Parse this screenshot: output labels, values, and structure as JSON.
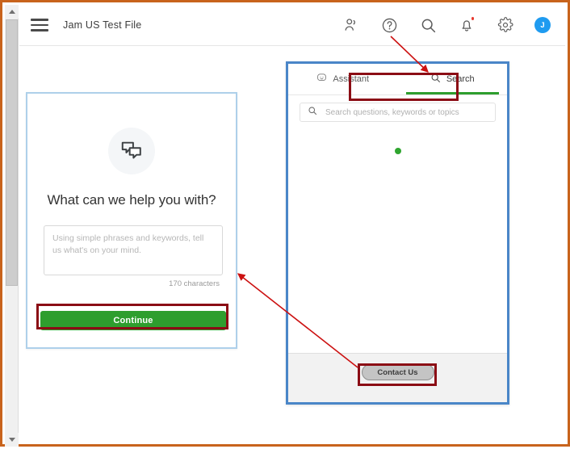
{
  "window": {
    "border_color": "#c8631c",
    "annotation_color": "#8b0d15"
  },
  "topbar": {
    "menu_icon": "hamburger-menu-icon",
    "title": "Jam US Test File",
    "icons": [
      {
        "name": "people-icon",
        "label": "People"
      },
      {
        "name": "help-icon",
        "label": "Help"
      },
      {
        "name": "search-icon",
        "label": "Search"
      },
      {
        "name": "notifications-bell-icon",
        "label": "Notifications",
        "badge": true
      },
      {
        "name": "settings-gear-icon",
        "label": "Settings"
      }
    ],
    "avatar_initial": "J",
    "avatar_color": "#1f9bf0"
  },
  "help_card": {
    "icon_name": "chat-bubbles-icon",
    "heading": "What can we help you with?",
    "textarea_placeholder": "Using simple phrases and keywords, tell us what's on your mind.",
    "textarea_value": "",
    "char_count": "170 characters",
    "continue_label": "Continue",
    "continue_color": "#2e9e2e",
    "border_color": "#aed0ea"
  },
  "widget": {
    "border_color": "#4a86c8",
    "tabs": [
      {
        "label": "Assistant",
        "icon": "assistant-bubble-icon",
        "active": false
      },
      {
        "label": "Search",
        "icon": "search-icon",
        "active": true
      }
    ],
    "active_tab_underline_color": "#2e9e2e",
    "search_placeholder": "Search questions, keywords or topics",
    "search_value": "",
    "loading_indicator": "green-loading-dot",
    "loading_color": "#2fa52f",
    "footer": {
      "contact_label": "Contact Us"
    }
  }
}
